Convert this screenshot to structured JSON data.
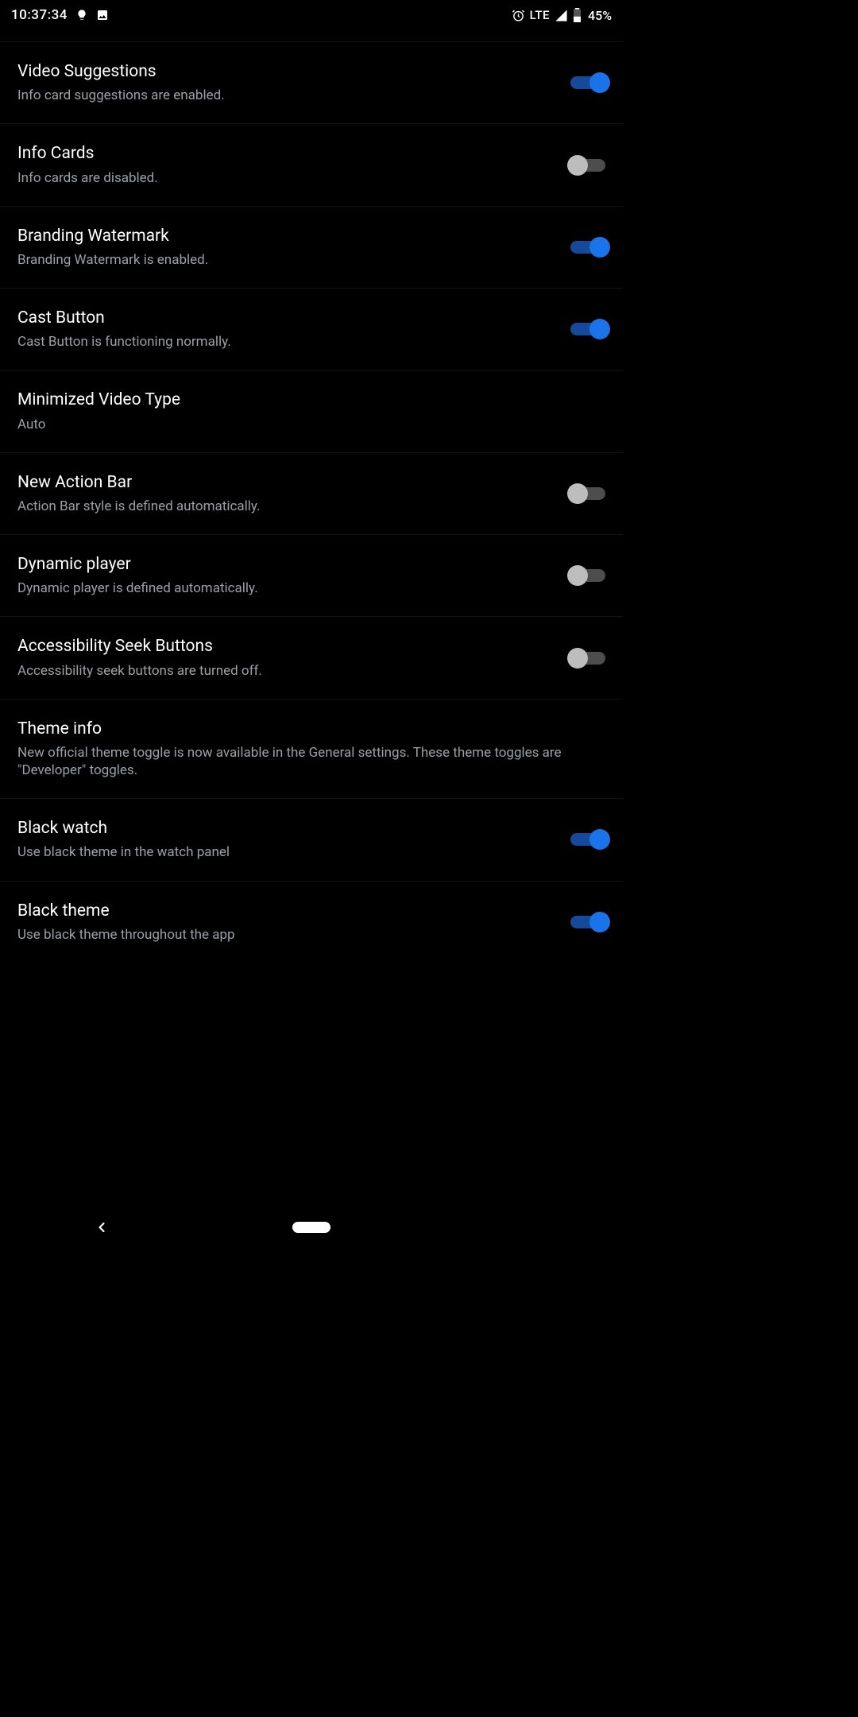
{
  "status": {
    "time": "10:37:34",
    "network": "LTE",
    "battery": "45%"
  },
  "settings": [
    {
      "id": "video-suggestions",
      "title": "Video Suggestions",
      "sub": "Info card suggestions are enabled.",
      "toggle": true,
      "on": true
    },
    {
      "id": "info-cards",
      "title": "Info Cards",
      "sub": "Info cards are disabled.",
      "toggle": true,
      "on": false
    },
    {
      "id": "branding-watermark",
      "title": "Branding Watermark",
      "sub": "Branding Watermark is enabled.",
      "toggle": true,
      "on": true
    },
    {
      "id": "cast-button",
      "title": "Cast Button",
      "sub": "Cast Button is functioning normally.",
      "toggle": true,
      "on": true
    },
    {
      "id": "minimized-video-type",
      "title": "Minimized Video Type",
      "sub": "Auto",
      "toggle": false
    },
    {
      "id": "new-action-bar",
      "title": "New Action Bar",
      "sub": "Action Bar style is defined automatically.",
      "toggle": true,
      "on": false
    },
    {
      "id": "dynamic-player",
      "title": "Dynamic player",
      "sub": "Dynamic player is defined automatically.",
      "toggle": true,
      "on": false
    },
    {
      "id": "accessibility-seek-buttons",
      "title": "Accessibility Seek Buttons",
      "sub": "Accessibility seek buttons are turned off.",
      "toggle": true,
      "on": false
    },
    {
      "id": "theme-info",
      "title": "Theme info",
      "sub": "New official theme toggle is now available in the General settings. These theme toggles are \"Developer\" toggles.",
      "toggle": false
    },
    {
      "id": "black-watch",
      "title": "Black watch",
      "sub": "Use black theme in the watch panel",
      "toggle": true,
      "on": true
    },
    {
      "id": "black-theme",
      "title": "Black theme",
      "sub": "Use black theme throughout the app",
      "toggle": true,
      "on": true
    }
  ]
}
